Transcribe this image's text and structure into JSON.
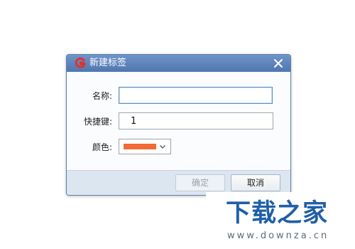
{
  "dialog": {
    "title": "新建标签",
    "fields": {
      "name_label": "名称:",
      "name_value": "",
      "shortcut_label": "快捷键:",
      "shortcut_value": "1",
      "color_label": "颜色:",
      "color_value": "#f26a35"
    },
    "buttons": {
      "ok_label": "确定",
      "ok_disabled": true,
      "cancel_label": "取消"
    },
    "icons": {
      "app": "g-logo-icon",
      "close": "close-icon",
      "dropdown": "chevron-down-icon"
    }
  },
  "watermark": {
    "title": "下载之家",
    "url": "www.downza.cn"
  },
  "colors": {
    "titlebar": "#5a80b8",
    "accent": "#1f5fa8",
    "logo_red": "#e0322b"
  }
}
